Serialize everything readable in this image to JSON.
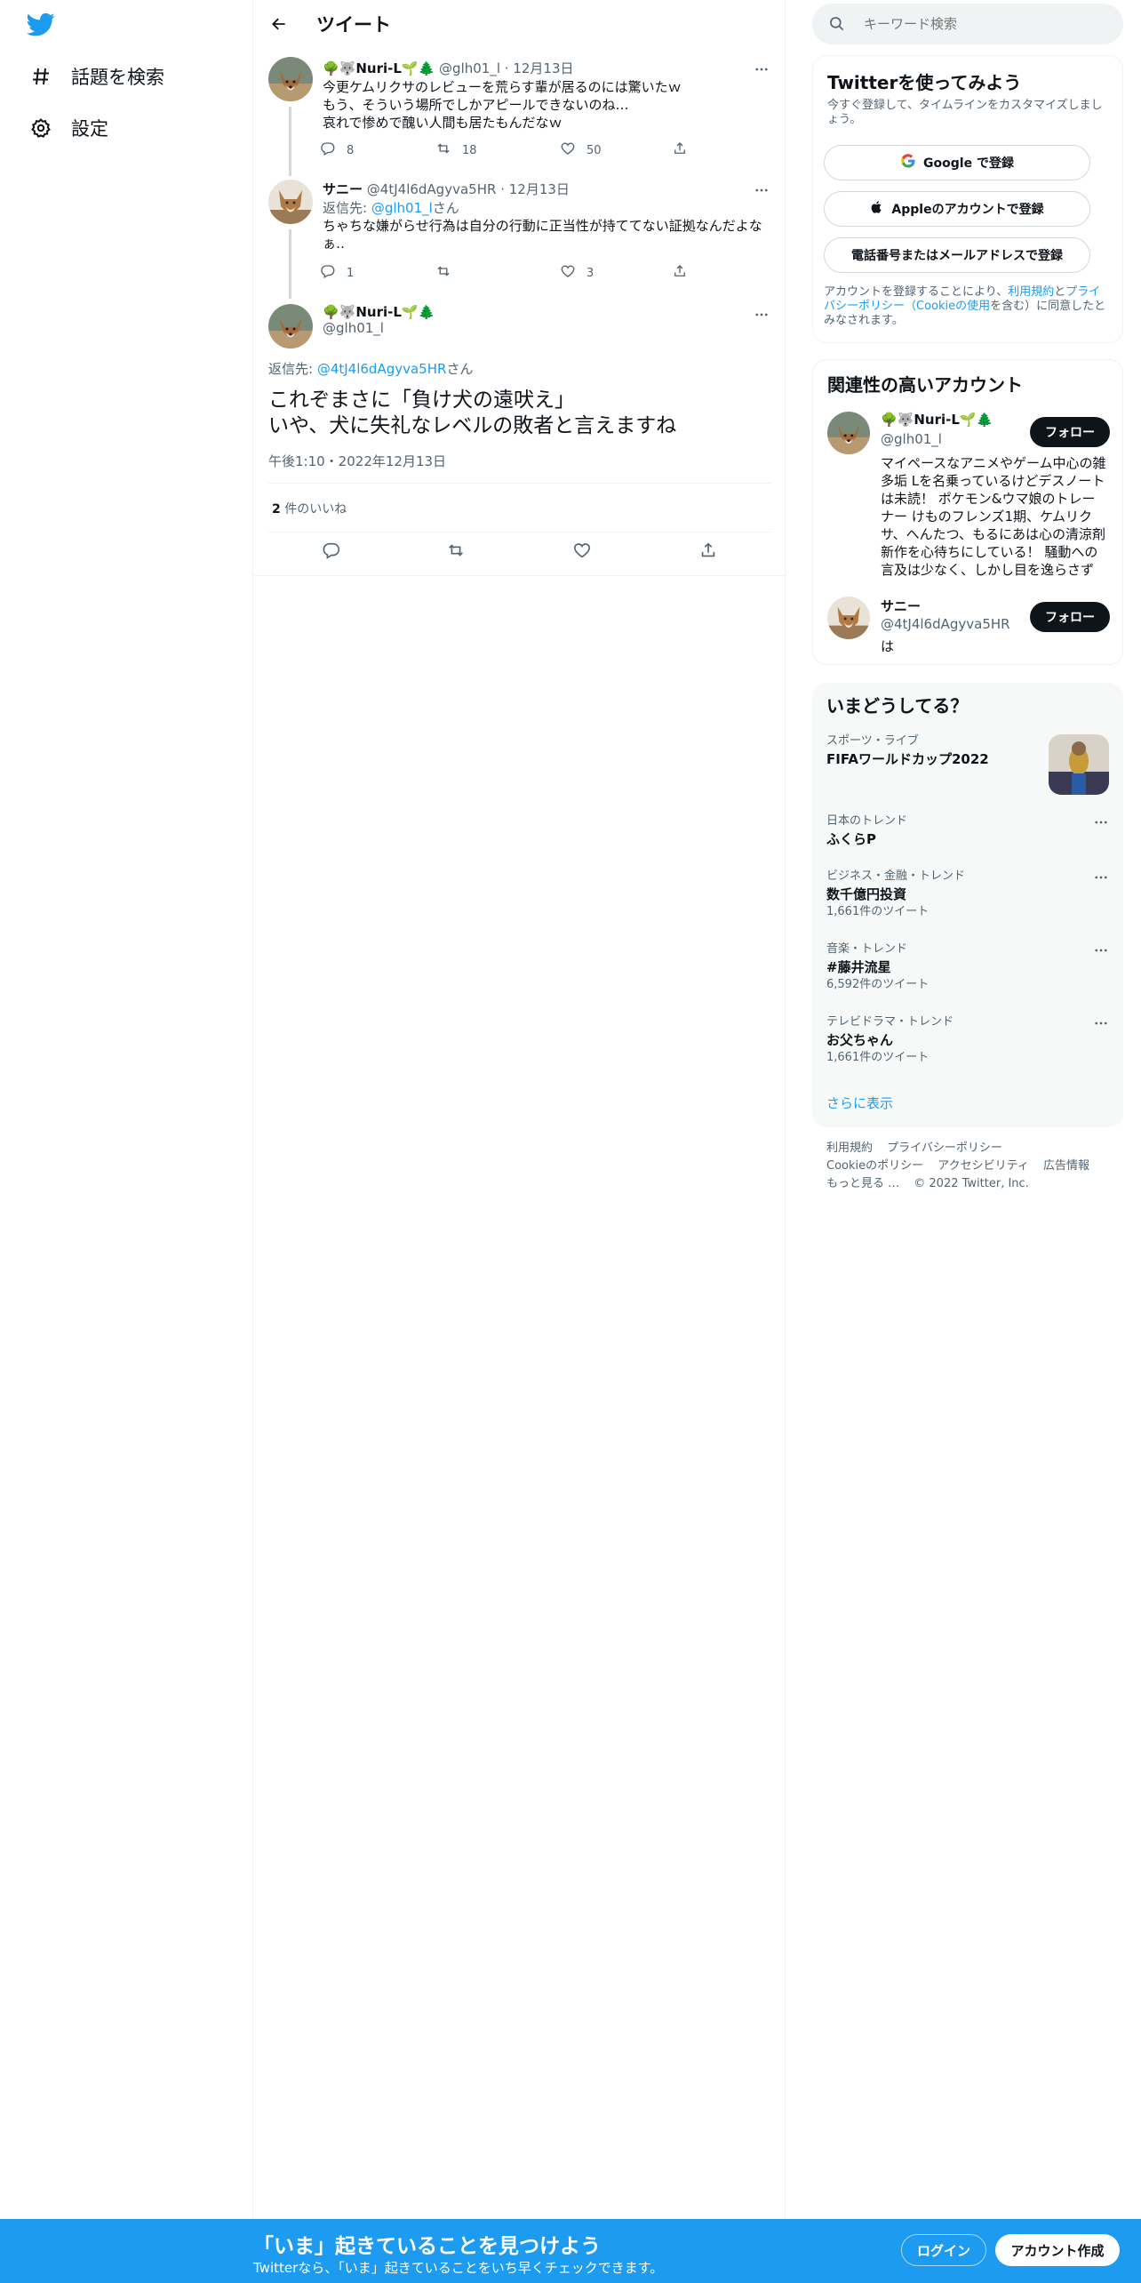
{
  "nav": {
    "items": [
      {
        "label": "話題を検索",
        "icon": "hashtag-icon"
      },
      {
        "label": "設定",
        "icon": "gear-icon"
      }
    ]
  },
  "header": {
    "title": "ツイート"
  },
  "thread": [
    {
      "name": "🌳🐺Nuri-L🌱🌲",
      "handle": "@glh01_l",
      "date": "12月13日",
      "lines": [
        "今更ケムリクサのレビューを荒らす輩が居るのには驚いたｗ",
        "もう、そういう場所でしかアピールできないのね…",
        "哀れで惨めで醜い人間も居たもんだなｗ"
      ],
      "replies": "8",
      "retweets": "18",
      "likes": "50"
    },
    {
      "name": "サニー",
      "handle": "@4tJ4l6dAgyva5HR",
      "date": "12月13日",
      "reply_prefix": "返信先: ",
      "reply_to": "@glh01_l",
      "reply_suffix": "さん",
      "lines": [
        "ちゃちな嫌がらせ行為は自分の行動に正当性が持ててない証拠なんだよな",
        "ぁ‥"
      ],
      "replies": "1",
      "retweets": "",
      "likes": "3"
    }
  ],
  "focus": {
    "name": "🌳🐺Nuri-L🌱🌲",
    "handle": "@glh01_l",
    "reply_prefix": "返信先: ",
    "reply_to": "@4tJ4l6dAgyva5HR",
    "reply_suffix": "さん",
    "lines": [
      "これぞまさに「負け犬の遠吠え」",
      "いや、犬に失礼なレベルの敗者と言えますね"
    ],
    "time": "午後1:10・2022年12月13日",
    "likes_count": "2",
    "likes_label": " 件のいいね"
  },
  "search": {
    "placeholder": "キーワード検索"
  },
  "signup": {
    "title": "Twitterを使ってみよう",
    "subtitle": "今すぐ登録して、タイムラインをカスタマイズしましょう。",
    "google": "Google で登録",
    "apple": "Appleのアカウントで登録",
    "phone": "電話番号またはメールアドレスで登録",
    "legal_prefix": "アカウントを登録することにより、",
    "legal_terms": "利用規約",
    "legal_and": "と",
    "legal_privacy": "プライバシーポリシー（Cookieの使用",
    "legal_suffix": "を含む）に同意したとみなされます。"
  },
  "related": {
    "title": "関連性の高いアカウント",
    "accounts": [
      {
        "name": "🌳🐺Nuri-L🌱🌲",
        "handle": "@glh01_l",
        "bio": "マイペースなアニメやゲーム中心の雑多垢 Lを名乗っているけどデスノートは未読！ ポケモン&ウマ娘のトレーナー けものフレンズ1期、ケムリクサ、へんたつ、もるにあは心の清涼剤 新作を心待ちにしている！ 騒動への言及は少なく、しかし目を逸らさず",
        "follow": "フォロー"
      },
      {
        "name": "サニー",
        "handle": "@4tJ4l6dAgyva5HR",
        "bio": "は",
        "follow": "フォロー"
      }
    ]
  },
  "trends": {
    "title": "いまどうしてる？",
    "items": [
      {
        "category": "スポーツ・ライブ",
        "name": "FIFAワールドカップ2022",
        "count": ""
      },
      {
        "category": "日本のトレンド",
        "name": "ふくらP",
        "count": ""
      },
      {
        "category": "ビジネス・金融・トレンド",
        "name": "数千億円投資",
        "count": "1,661件のツイート"
      },
      {
        "category": "音楽・トレンド",
        "name": "#藤井流星",
        "count": "6,592件のツイート"
      },
      {
        "category": "テレビドラマ・トレンド",
        "name": "お父ちゃん",
        "count": "1,661件のツイート"
      }
    ],
    "show_more": "さらに表示"
  },
  "footer": {
    "row1": [
      "利用規約",
      "プライバシーポリシー"
    ],
    "row2": [
      "Cookieのポリシー",
      "アクセシビリティ",
      "広告情報"
    ],
    "row3": [
      "もっと見る …",
      "© 2022 Twitter, Inc."
    ]
  },
  "bottombar": {
    "title": "「いま」起きていることを見つけよう",
    "subtitle": "Twitterなら、「いま」起きていることをいち早くチェックできます。",
    "login": "ログイン",
    "create": "アカウント作成"
  },
  "colors": {
    "accent": "#1d9bf0",
    "text": "#0f1419",
    "muted": "#536471"
  }
}
